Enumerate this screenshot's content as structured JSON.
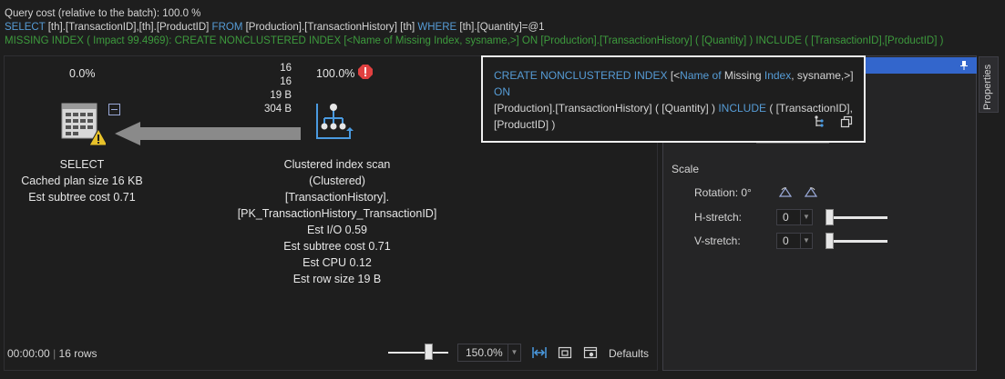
{
  "header": {
    "query_cost": "Query cost (relative to the batch):  100.0 %",
    "select_kw": "SELECT",
    "select_cols": " [th].[TransactionID],[th].[ProductID] ",
    "from_kw": "FROM",
    "from_table": " [Production].[TransactionHistory] [th] ",
    "where_kw": "WHERE",
    "where_cond": " [th].[Quantity]=@1",
    "missing_index": "MISSING INDEX ( Impact 99.4969): CREATE NONCLUSTERED INDEX [<Name of Missing Index, sysname,>] ON [Production].[TransactionHistory]  ( [Quantity] ) INCLUDE ( [TransactionID],[ProductID] )"
  },
  "plan": {
    "select_node": {
      "percent": "0.0%",
      "title": "SELECT",
      "line1": "Cached plan size  16 KB",
      "line2": "Est subtree cost  0.71"
    },
    "edge": {
      "rows_actual": "16",
      "rows_est": "16",
      "row_size": "19 B",
      "data_size": "304 B"
    },
    "scan_node": {
      "percent": "100.0%",
      "lines": [
        "Clustered index scan",
        "(Clustered)",
        "[TransactionHistory].",
        "[PK_TransactionHistory_TransactionID]",
        "Est I/O  0.59",
        "Est subtree cost  0.71",
        "Est CPU  0.12",
        "Est row size  19 B"
      ]
    }
  },
  "tooltip": {
    "create_kw": "CREATE NONCLUSTERED INDEX",
    "bracket_open": " [<",
    "name_kw": "Name of",
    "missing": " Missing ",
    "index_kw": "Index",
    "sysname": ", sysname,>] ",
    "on_kw": "ON",
    "line2": "[Production].[TransactionHistory]  ( [Quantity] ) ",
    "include_kw": "INCLUDE",
    "line2b": " ( [TransactionID],",
    "line3": "[ProductID] )"
  },
  "panel": {
    "scale_label": "Scale",
    "rotation_label": "Rotation: 0°",
    "hstretch_label": "H-stretch:",
    "hstretch_value": "0",
    "vstretch_label": "V-stretch:",
    "vstretch_value": "0",
    "properties_tab": "Properties"
  },
  "footer": {
    "time": "00:00:00",
    "rows": "16 rows",
    "zoom": "150.0%",
    "defaults": "Defaults"
  },
  "colors": {
    "keyword": "#569cd6",
    "green": "#3d9a3d",
    "accent": "#3366cc",
    "warning": "#e8c22a",
    "error": "#e04040"
  }
}
